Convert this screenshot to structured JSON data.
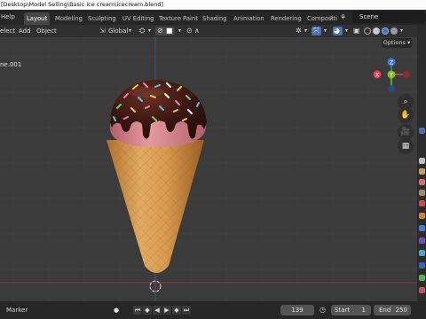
{
  "window": {
    "title": "[Desktop\\Model Selling\\Basic ice cream\\icecream.blend]"
  },
  "menu": {
    "help": "Help"
  },
  "workspace_tabs": [
    "Layout",
    "Modeling",
    "Sculpting",
    "UV Editing",
    "Texture Paint",
    "Shading",
    "Animation",
    "Rendering",
    "Compositi"
  ],
  "active_tab": "Layout",
  "scene": {
    "label": "Scene"
  },
  "viewport_header": {
    "select": "elect",
    "add": "Add",
    "object": "Object",
    "orientation": "Global"
  },
  "viewport": {
    "options": "Options",
    "object_label": "ne.001",
    "gizmo": {
      "x": "X",
      "y": "Y",
      "z": "Z"
    }
  },
  "timeline": {
    "marker": "Marker",
    "current_frame": "139",
    "start_label": "Start",
    "start": "1",
    "end_label": "End",
    "end": "250"
  },
  "colors": {
    "cone": "#d8a05a",
    "cone_shadow": "#a8682a",
    "ice_cream": "#d8848e",
    "chocolate": "#3a1610",
    "axis_x": "#e0424e",
    "axis_y": "#7cbf1e",
    "axis_z": "#3b7ae0",
    "accent_blue": "#4772b3"
  },
  "icons": [
    "select-box-icon",
    "transform-pivot-icon",
    "snap-icon",
    "proportional-edit-icon",
    "view-object-types-icon",
    "gizmo-icon",
    "overlay-icon",
    "xray-icon",
    "zoom-icon",
    "hand-pan-icon",
    "camera-icon",
    "grid-icon",
    "play-icon",
    "jump-start-icon",
    "jump-end-icon",
    "record-icon",
    "clock-icon"
  ]
}
